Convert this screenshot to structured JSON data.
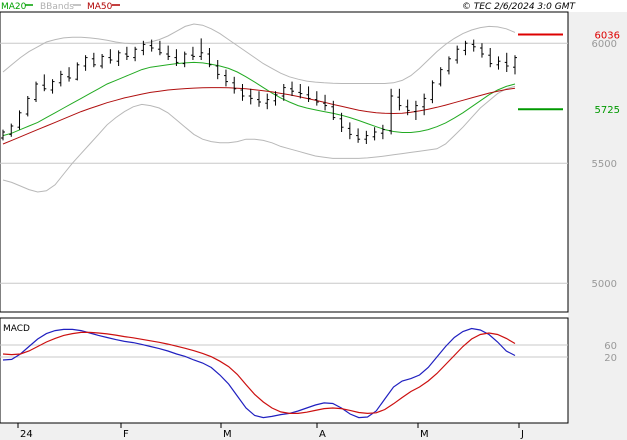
{
  "header": {
    "legend": [
      {
        "label": "MA20",
        "color": "#00a000"
      },
      {
        "label": "BBands",
        "color": "#b0b0b0"
      },
      {
        "label": "MA50",
        "color": "#b00000"
      }
    ],
    "copyright": "© TEC 2/6/2024 3:0 GMT"
  },
  "colors": {
    "bars": "#000000",
    "ma20": "#22aa22",
    "ma50": "#b01010",
    "bbands": "#b8b8b8",
    "macd": "#2020c0",
    "signal": "#cc1010",
    "grid": "#c8c8c8",
    "axis_panel": "#f0f0f0",
    "resistance": "#dd0000",
    "support": "#009900"
  },
  "chart_data": [
    {
      "type": "ohlc",
      "x_ticks": [
        "24",
        "F",
        "M",
        "A",
        "M",
        "J"
      ],
      "y_ticks": [
        "6000",
        "5500",
        "5000"
      ],
      "ylim": [
        4880,
        6130
      ],
      "levels": [
        {
          "label": "6036",
          "value": 6036,
          "color": "#dd0000"
        },
        {
          "label": "5725",
          "value": 5725,
          "color": "#009900"
        }
      ],
      "series": [
        {
          "name": "MA20",
          "values": [
            5615,
            5625,
            5640,
            5655,
            5670,
            5690,
            5710,
            5730,
            5750,
            5770,
            5790,
            5810,
            5830,
            5845,
            5860,
            5875,
            5890,
            5900,
            5905,
            5910,
            5915,
            5918,
            5920,
            5918,
            5912,
            5905,
            5895,
            5880,
            5860,
            5838,
            5815,
            5792,
            5772,
            5755,
            5740,
            5730,
            5722,
            5715,
            5708,
            5700,
            5690,
            5678,
            5665,
            5652,
            5640,
            5632,
            5628,
            5628,
            5632,
            5640,
            5652,
            5668,
            5688,
            5710,
            5735,
            5760,
            5785,
            5805,
            5820,
            5830
          ]
        },
        {
          "name": "MA50",
          "values": [
            5580,
            5595,
            5610,
            5625,
            5640,
            5655,
            5670,
            5685,
            5700,
            5715,
            5728,
            5740,
            5752,
            5762,
            5772,
            5780,
            5788,
            5795,
            5800,
            5805,
            5808,
            5811,
            5813,
            5814,
            5815,
            5815,
            5814,
            5812,
            5810,
            5806,
            5802,
            5797,
            5791,
            5785,
            5778,
            5770,
            5762,
            5754,
            5745,
            5737,
            5729,
            5721,
            5715,
            5710,
            5708,
            5707,
            5708,
            5712,
            5718,
            5725,
            5733,
            5742,
            5752,
            5762,
            5772,
            5782,
            5792,
            5800,
            5807,
            5812
          ]
        },
        {
          "name": "BBands Upper",
          "values": [
            5880,
            5910,
            5940,
            5965,
            5985,
            6005,
            6015,
            6022,
            6025,
            6025,
            6022,
            6018,
            6012,
            6005,
            6000,
            5998,
            5999,
            6005,
            6015,
            6030,
            6050,
            6070,
            6080,
            6075,
            6060,
            6040,
            6015,
            5990,
            5965,
            5940,
            5915,
            5895,
            5875,
            5860,
            5850,
            5842,
            5838,
            5835,
            5833,
            5832,
            5832,
            5832,
            5832,
            5832,
            5832,
            5835,
            5845,
            5865,
            5895,
            5930,
            5965,
            5995,
            6020,
            6040,
            6055,
            6065,
            6070,
            6068,
            6060,
            6045
          ]
        },
        {
          "name": "BBands Lower",
          "values": [
            5430,
            5420,
            5405,
            5390,
            5380,
            5385,
            5410,
            5455,
            5500,
            5540,
            5580,
            5620,
            5660,
            5690,
            5715,
            5735,
            5745,
            5740,
            5730,
            5710,
            5680,
            5650,
            5620,
            5600,
            5590,
            5585,
            5585,
            5590,
            5600,
            5600,
            5595,
            5585,
            5570,
            5560,
            5550,
            5540,
            5530,
            5525,
            5520,
            5520,
            5520,
            5520,
            5522,
            5526,
            5530,
            5535,
            5540,
            5545,
            5550,
            5555,
            5560,
            5580,
            5615,
            5650,
            5690,
            5730,
            5760,
            5790,
            5810,
            5820
          ]
        }
      ],
      "ohlc_bars": [
        [
          5605,
          5640,
          5595,
          5630
        ],
        [
          5620,
          5665,
          5610,
          5655
        ],
        [
          5650,
          5720,
          5640,
          5710
        ],
        [
          5705,
          5780,
          5695,
          5770
        ],
        [
          5765,
          5840,
          5755,
          5830
        ],
        [
          5825,
          5870,
          5800,
          5810
        ],
        [
          5805,
          5850,
          5790,
          5840
        ],
        [
          5835,
          5885,
          5820,
          5870
        ],
        [
          5860,
          5900,
          5840,
          5855
        ],
        [
          5850,
          5920,
          5845,
          5910
        ],
        [
          5905,
          5950,
          5885,
          5940
        ],
        [
          5935,
          5960,
          5900,
          5910
        ],
        [
          5905,
          5955,
          5895,
          5945
        ],
        [
          5940,
          5975,
          5915,
          5930
        ],
        [
          5925,
          5970,
          5905,
          5960
        ],
        [
          5955,
          5985,
          5930,
          5945
        ],
        [
          5940,
          5985,
          5925,
          5975
        ],
        [
          5970,
          6010,
          5950,
          5995
        ],
        [
          5990,
          6015,
          5965,
          5980
        ],
        [
          5975,
          6010,
          5950,
          5960
        ],
        [
          5955,
          5990,
          5930,
          5945
        ],
        [
          5940,
          5975,
          5905,
          5920
        ],
        [
          5915,
          5965,
          5900,
          5955
        ],
        [
          5950,
          5985,
          5930,
          5945
        ],
        [
          5945,
          6020,
          5930,
          5960
        ],
        [
          5955,
          5980,
          5900,
          5910
        ],
        [
          5905,
          5930,
          5850,
          5870
        ],
        [
          5865,
          5890,
          5820,
          5840
        ],
        [
          5835,
          5860,
          5790,
          5810
        ],
        [
          5805,
          5830,
          5760,
          5780
        ],
        [
          5780,
          5810,
          5745,
          5770
        ],
        [
          5765,
          5800,
          5735,
          5755
        ],
        [
          5750,
          5790,
          5725,
          5765
        ],
        [
          5760,
          5800,
          5740,
          5785
        ],
        [
          5780,
          5830,
          5760,
          5815
        ],
        [
          5810,
          5840,
          5780,
          5800
        ],
        [
          5795,
          5830,
          5770,
          5790
        ],
        [
          5785,
          5820,
          5755,
          5770
        ],
        [
          5765,
          5800,
          5740,
          5755
        ],
        [
          5750,
          5785,
          5720,
          5740
        ],
        [
          5735,
          5760,
          5680,
          5690
        ],
        [
          5685,
          5710,
          5630,
          5650
        ],
        [
          5645,
          5670,
          5600,
          5620
        ],
        [
          5615,
          5645,
          5585,
          5600
        ],
        [
          5600,
          5635,
          5580,
          5615
        ],
        [
          5610,
          5650,
          5595,
          5630
        ],
        [
          5625,
          5660,
          5600,
          5640
        ],
        [
          5635,
          5810,
          5620,
          5780
        ],
        [
          5775,
          5810,
          5720,
          5740
        ],
        [
          5735,
          5765,
          5700,
          5720
        ],
        [
          5715,
          5760,
          5680,
          5740
        ],
        [
          5735,
          5790,
          5700,
          5770
        ],
        [
          5765,
          5845,
          5750,
          5835
        ],
        [
          5830,
          5900,
          5820,
          5890
        ],
        [
          5885,
          5945,
          5870,
          5935
        ],
        [
          5930,
          5990,
          5915,
          5975
        ],
        [
          5970,
          6010,
          5950,
          6000
        ],
        [
          5995,
          6015,
          5965,
          5985
        ],
        [
          5980,
          6000,
          5940,
          5955
        ],
        [
          5950,
          5980,
          5900,
          5915
        ],
        [
          5910,
          5945,
          5890,
          5925
        ],
        [
          5920,
          5960,
          5880,
          5905
        ],
        [
          5900,
          5950,
          5870,
          5940
        ]
      ]
    },
    {
      "type": "line",
      "title": "MACD",
      "y_ticks": [
        "60",
        "20"
      ],
      "ylim": [
        -200,
        150
      ],
      "series": [
        {
          "name": "MACD",
          "values": [
            10,
            12,
            30,
            55,
            80,
            98,
            108,
            112,
            112,
            108,
            100,
            92,
            85,
            78,
            72,
            68,
            62,
            55,
            48,
            40,
            30,
            22,
            10,
            0,
            -15,
            -40,
            -70,
            -110,
            -150,
            -175,
            -182,
            -178,
            -172,
            -168,
            -160,
            -150,
            -140,
            -133,
            -135,
            -150,
            -170,
            -182,
            -180,
            -160,
            -120,
            -80,
            -60,
            -52,
            -40,
            -15,
            20,
            55,
            85,
            105,
            115,
            110,
            95,
            70,
            40,
            25
          ]
        },
        {
          "name": "Signal",
          "values": [
            30,
            28,
            30,
            40,
            55,
            70,
            82,
            92,
            98,
            102,
            102,
            100,
            97,
            93,
            88,
            84,
            79,
            74,
            69,
            63,
            56,
            49,
            41,
            32,
            21,
            6,
            -12,
            -38,
            -72,
            -105,
            -130,
            -150,
            -163,
            -168,
            -168,
            -164,
            -158,
            -152,
            -150,
            -152,
            -158,
            -165,
            -168,
            -166,
            -155,
            -136,
            -115,
            -95,
            -80,
            -60,
            -35,
            -5,
            25,
            55,
            80,
            95,
            100,
            95,
            82,
            65
          ]
        }
      ]
    }
  ]
}
